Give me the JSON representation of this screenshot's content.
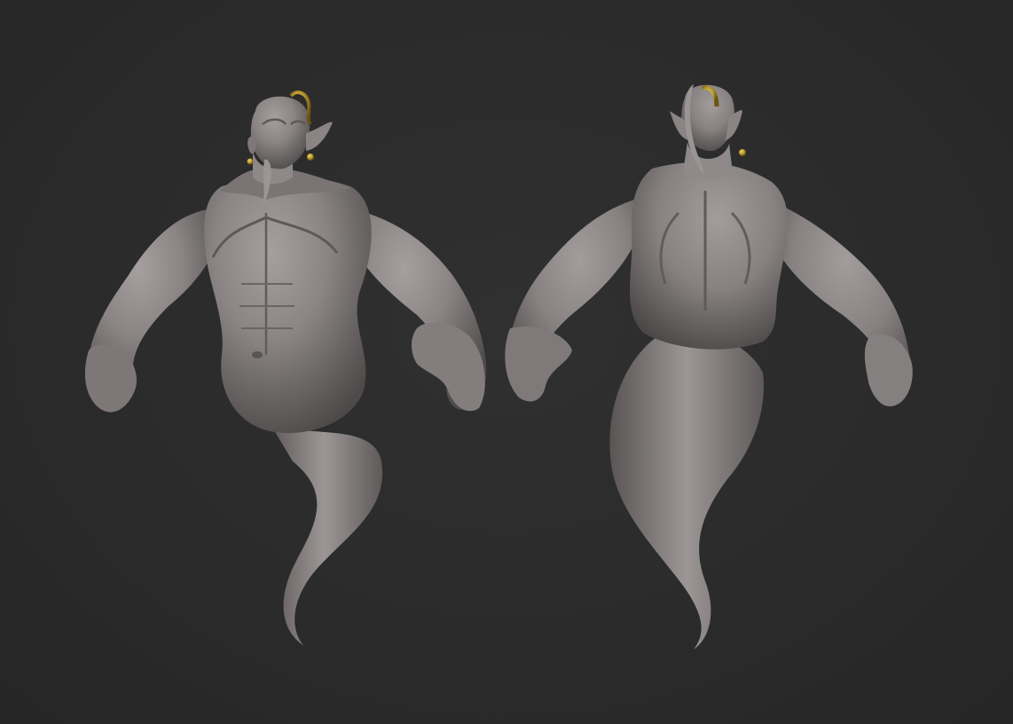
{
  "viewport": {
    "background_color": "#2b2b2b",
    "surface_color": "#8a8484",
    "accent_gold": "#b89a2e"
  },
  "models": [
    {
      "view": "front",
      "subject": "genie-sculpt"
    },
    {
      "view": "back",
      "subject": "genie-sculpt"
    }
  ]
}
